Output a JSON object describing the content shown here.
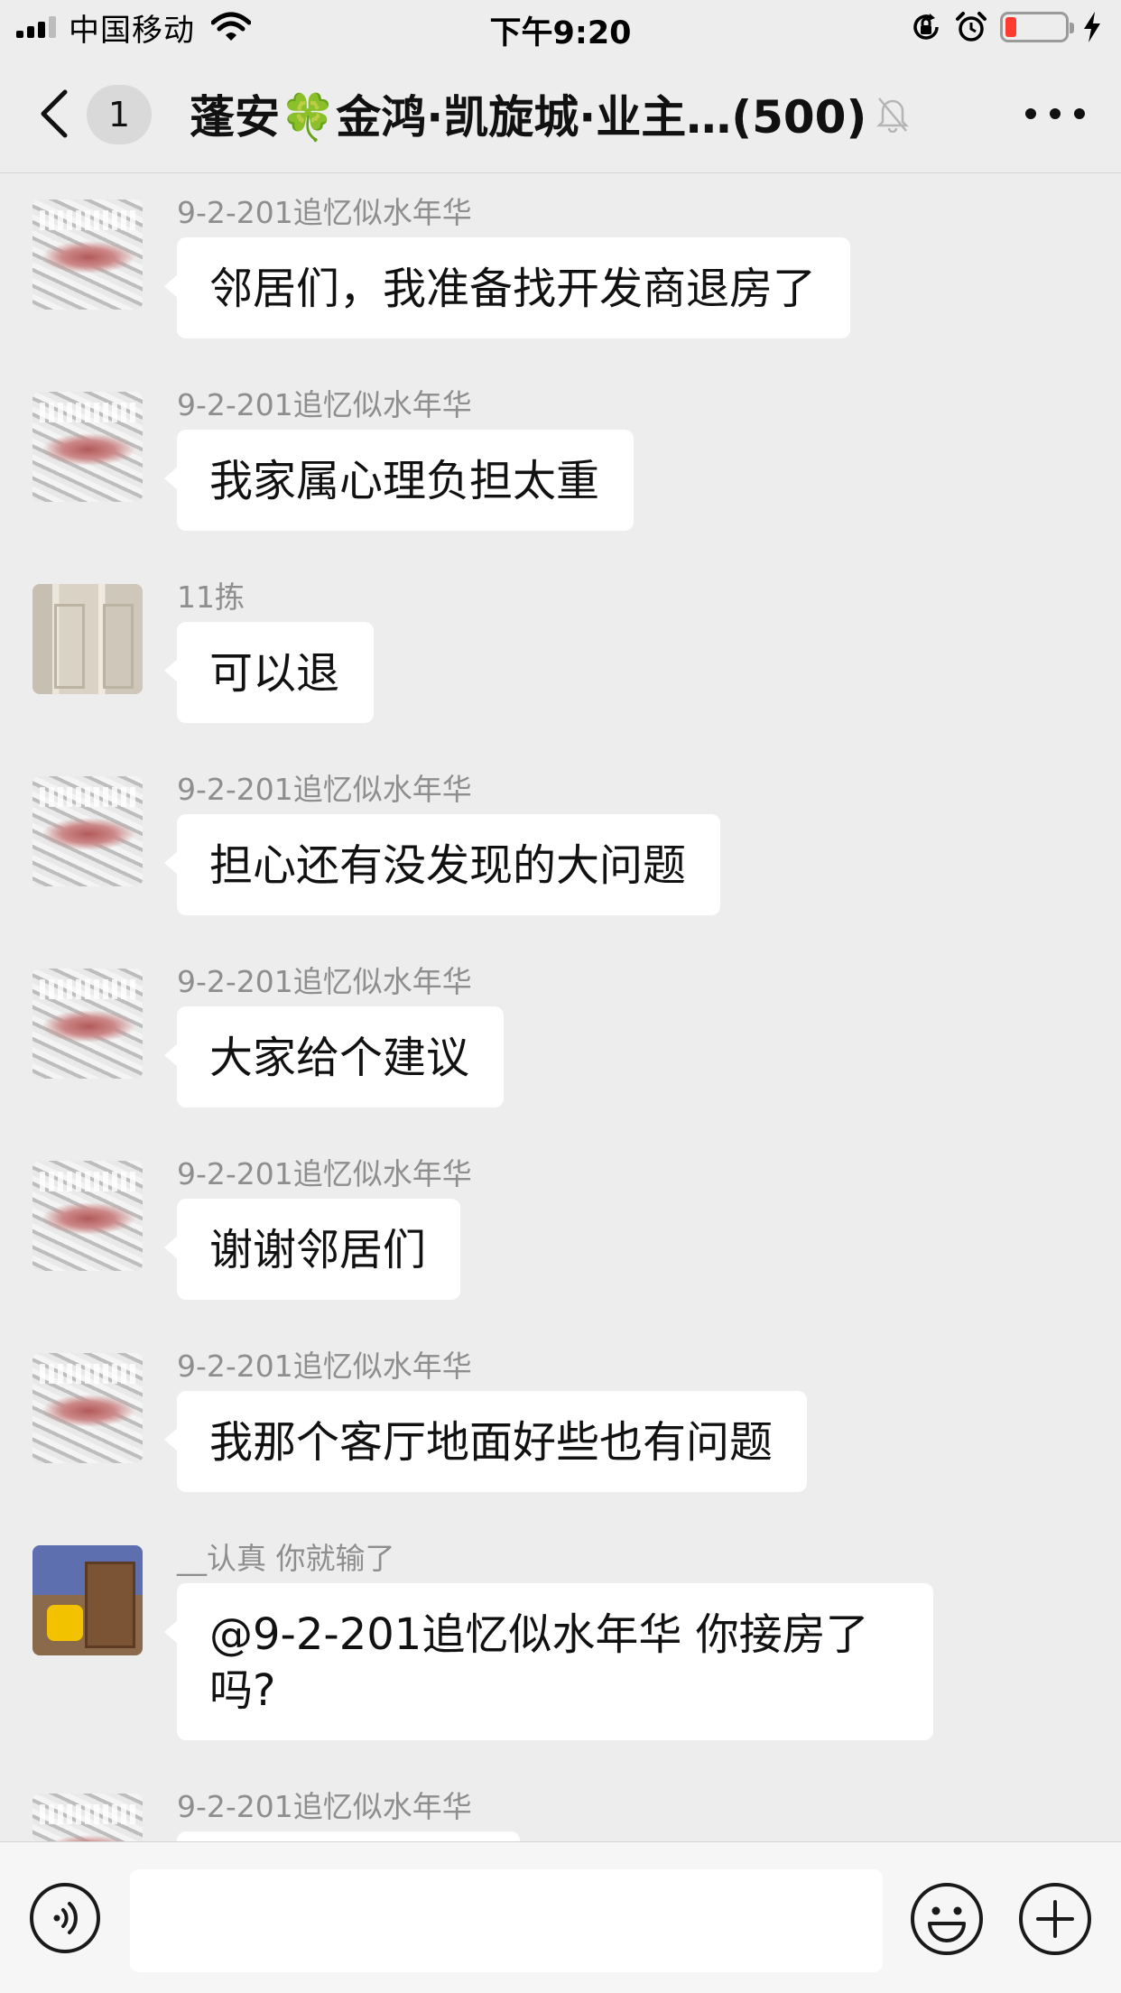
{
  "status_bar": {
    "carrier": "中国移动",
    "time": "下午9:20"
  },
  "nav": {
    "back_count": "1",
    "title": "蓬安🍀金鸿·凯旋城·业主…(500)"
  },
  "messages": [
    {
      "sender": "9-2-201追忆似水年华",
      "text": "邻居们，我准备找开发商退房了",
      "avatar": "avatar-flowers"
    },
    {
      "sender": "9-2-201追忆似水年华",
      "text": "我家属心理负担太重",
      "avatar": "avatar-flowers"
    },
    {
      "sender": "11拣",
      "text": "可以退",
      "avatar": "avatar-door"
    },
    {
      "sender": "9-2-201追忆似水年华",
      "text": "担心还有没发现的大问题",
      "avatar": "avatar-flowers"
    },
    {
      "sender": "9-2-201追忆似水年华",
      "text": "大家给个建议",
      "avatar": "avatar-flowers"
    },
    {
      "sender": "9-2-201追忆似水年华",
      "text": "谢谢邻居们",
      "avatar": "avatar-flowers"
    },
    {
      "sender": "9-2-201追忆似水年华",
      "text": "我那个客厅地面好些也有问题",
      "avatar": "avatar-flowers"
    },
    {
      "sender": "__认真  你就输了",
      "text": "@9-2-201追忆似水年华 你接房了吗?",
      "avatar": "avatar-game"
    },
    {
      "sender": "9-2-201追忆似水年华",
      "text": "",
      "avatar": "avatar-flowers"
    }
  ],
  "input": {
    "value": ""
  },
  "icons": {
    "back": "chevron-left-icon",
    "mute": "bell-off-icon",
    "more": "more-dots-icon",
    "voice": "voice-icon",
    "emoji": "emoji-icon",
    "plus": "plus-icon"
  }
}
